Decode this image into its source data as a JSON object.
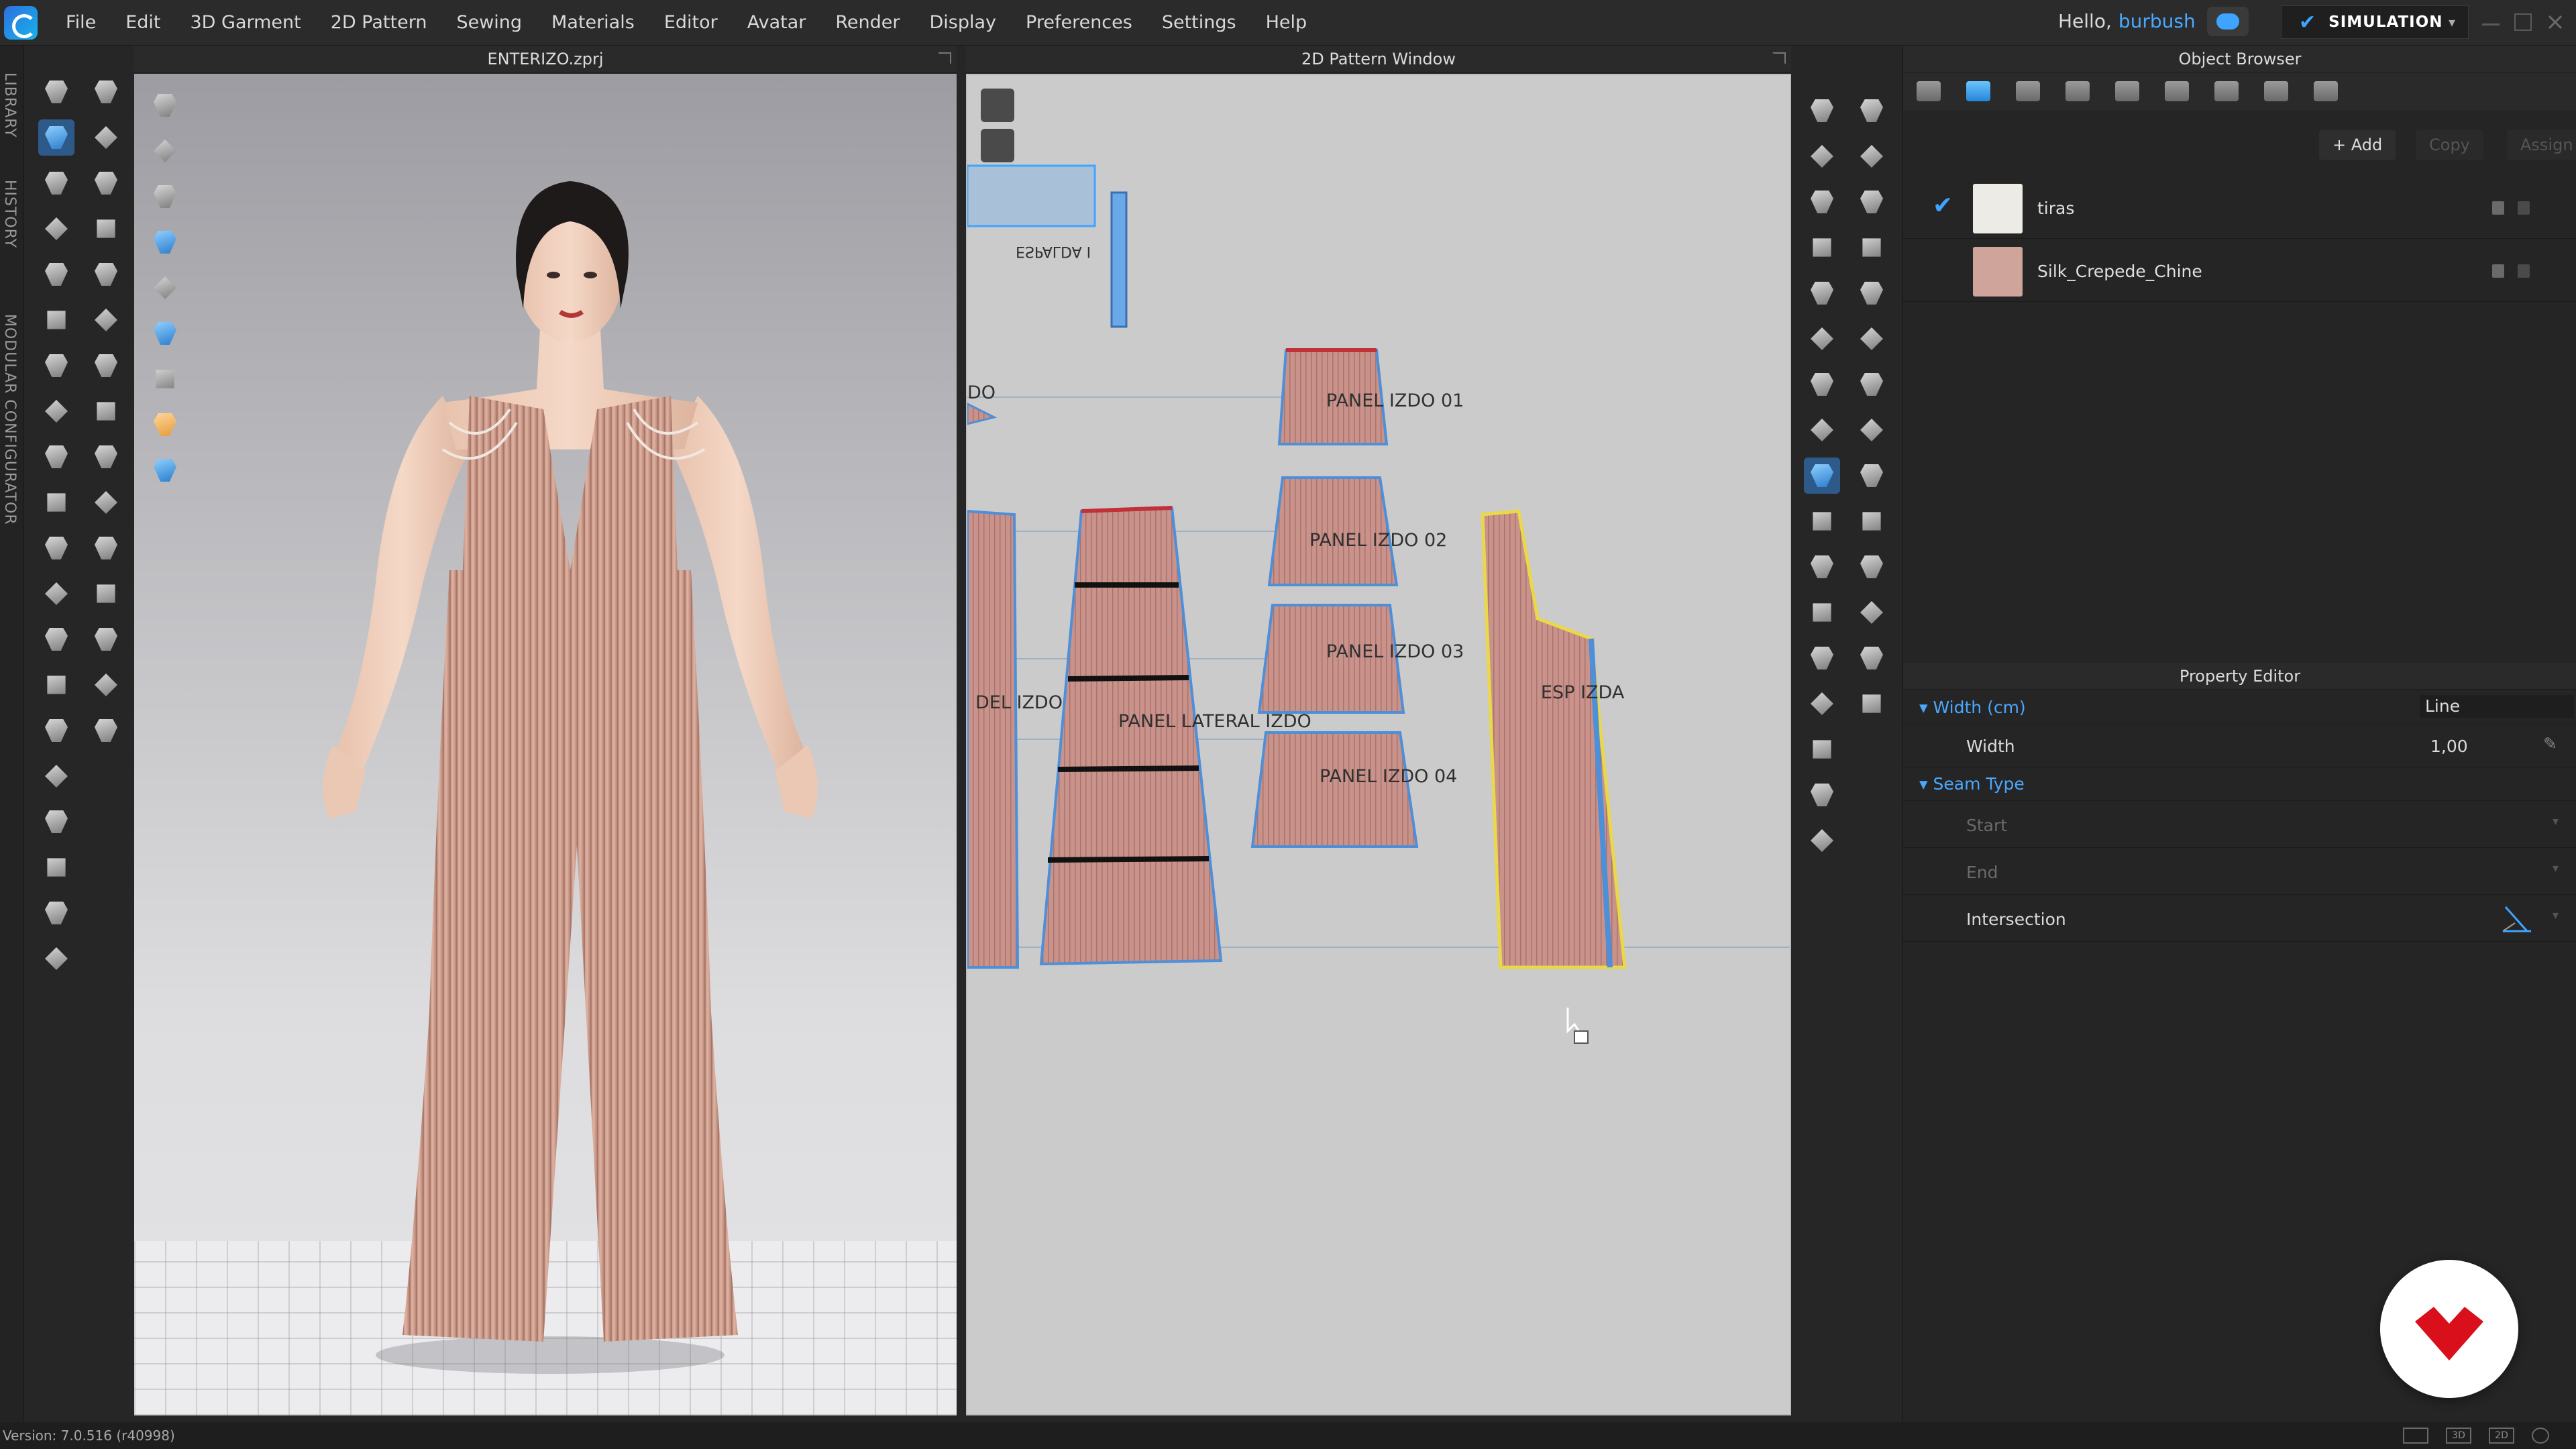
{
  "menubar": {
    "items": [
      "File",
      "Edit",
      "3D Garment",
      "2D Pattern",
      "Sewing",
      "Materials",
      "Editor",
      "Avatar",
      "Render",
      "Display",
      "Preferences",
      "Settings",
      "Help"
    ],
    "greeting": "Hello,",
    "username": "burbush",
    "simulation_label": "SIMULATION"
  },
  "left_tabs": [
    "LIBRARY",
    "HISTORY",
    "MODULAR CONFIGURATOR"
  ],
  "viewport3d": {
    "title": "ENTERIZO.zprj"
  },
  "viewport2d": {
    "title": "2D Pattern Window",
    "pieces": [
      {
        "label": "PANEL IZDO 01"
      },
      {
        "label": "PANEL IZDO 02"
      },
      {
        "label": "PANEL IZDO 03"
      },
      {
        "label": "PANEL IZDO 04"
      },
      {
        "label": "PANEL LATERAL IZDO"
      },
      {
        "label": "DEL IZDO"
      },
      {
        "label": "ESP IZDA"
      },
      {
        "label": "DO"
      },
      {
        "label": "ESPALDA I"
      }
    ]
  },
  "object_browser": {
    "title": "Object Browser",
    "add_label": "+ Add",
    "copy_label": "Copy",
    "assign_label": "Assign",
    "fabrics": [
      {
        "name": "tiras",
        "selected": true,
        "swatch_color": "#ecebe6"
      },
      {
        "name": "Silk_Crepede_Chine",
        "selected": false,
        "swatch_color": "#cfa49b"
      }
    ]
  },
  "property_editor": {
    "title": "Property Editor",
    "width_section": "Width (cm)",
    "width_mode": "Line",
    "width_label": "Width",
    "width_value": "1,00",
    "seam_section": "Seam Type",
    "start_label": "Start",
    "end_label": "End",
    "intersection_label": "Intersection"
  },
  "status": {
    "version": "Version: 7.0.516 (r40998)"
  },
  "colors": {
    "accent": "#3ea4ff",
    "fabric": "#cfa49b",
    "brand_red": "#d9101c"
  }
}
